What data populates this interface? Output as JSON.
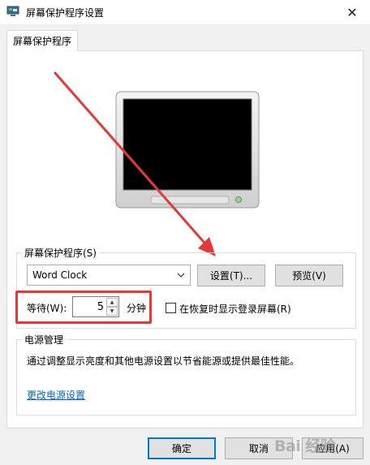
{
  "window": {
    "title": "屏幕保护程序设置",
    "close_glyph": "✕"
  },
  "tab": {
    "label": "屏幕保护程序"
  },
  "screensaver": {
    "group_label": "屏幕保护程序(S)",
    "selected": "Word Clock",
    "settings_button": "设置(T)...",
    "preview_button": "预览(V)",
    "wait_label": "等待(W):",
    "wait_value": "5",
    "wait_unit": "分钟",
    "resume_checkbox_label": "在恢复时显示登录屏幕(R)",
    "resume_checked": false
  },
  "power": {
    "group_label": "电源管理",
    "description": "通过调整显示亮度和其他电源设置以节省能源或提供最佳性能。",
    "link": "更改电源设置"
  },
  "footer": {
    "ok": "确定",
    "cancel": "取消",
    "apply": "应用(A)"
  },
  "watermark": "Bai 经验",
  "colors": {
    "annotation": "#e53935",
    "accent": "#0078d7",
    "link": "#0066cc"
  }
}
